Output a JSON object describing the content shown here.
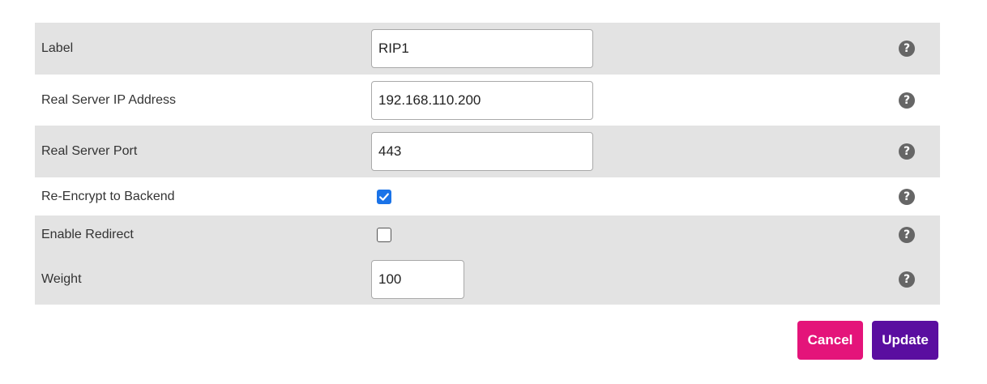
{
  "form": {
    "label": {
      "label": "Label",
      "value": "RIP1"
    },
    "ip": {
      "label": "Real Server IP Address",
      "value": "192.168.110.200"
    },
    "port": {
      "label": "Real Server Port",
      "value": "443"
    },
    "reencrypt": {
      "label": "Re-Encrypt to Backend",
      "checked": true
    },
    "redirect": {
      "label": "Enable Redirect",
      "checked": false
    },
    "weight": {
      "label": "Weight",
      "value": "100"
    }
  },
  "help_icon": "?",
  "buttons": {
    "cancel": "Cancel",
    "update": "Update"
  },
  "colors": {
    "row_shade": "#e3e3e3",
    "checkbox_checked": "#1a73e8",
    "help_icon": "#666666",
    "cancel_button": "#e4147a",
    "update_button": "#5a0ea0"
  },
  "icons": [
    "question-circle-icon",
    "checkmark-icon"
  ]
}
